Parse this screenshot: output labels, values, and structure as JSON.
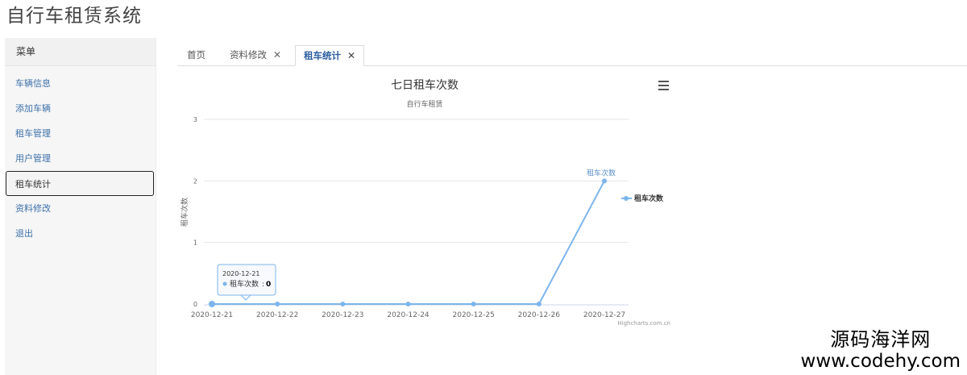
{
  "app": {
    "title": "自行车租赁系统"
  },
  "sidebar": {
    "header": "菜单",
    "items": [
      {
        "label": "车辆信息",
        "active": false
      },
      {
        "label": "添加车辆",
        "active": false
      },
      {
        "label": "租车管理",
        "active": false
      },
      {
        "label": "用户管理",
        "active": false
      },
      {
        "label": "租车统计",
        "active": true
      },
      {
        "label": "资料修改",
        "active": false
      },
      {
        "label": "退出",
        "active": false
      }
    ]
  },
  "tabs": [
    {
      "label": "首页",
      "closable": false,
      "active": false
    },
    {
      "label": "资料修改",
      "closable": true,
      "active": false
    },
    {
      "label": "租车统计",
      "closable": true,
      "active": true
    }
  ],
  "tab_close_glyph": "✕",
  "menu_icon": "hamburger-icon",
  "chart_data": {
    "type": "line",
    "title": "七日租车次数",
    "subtitle": "自行车租赁",
    "ylabel": "租车次数",
    "xlabel": "",
    "categories": [
      "2020-12-21",
      "2020-12-22",
      "2020-12-23",
      "2020-12-24",
      "2020-12-25",
      "2020-12-26",
      "2020-12-27"
    ],
    "series": [
      {
        "name": "租车次数",
        "values": [
          0,
          0,
          0,
          0,
          0,
          0,
          2
        ],
        "color": "#7cb5ec"
      }
    ],
    "ylim": [
      0,
      3
    ],
    "yticks": [
      0,
      1,
      2,
      3
    ],
    "grid": true,
    "legend": "right",
    "end_label": "租车次数",
    "tooltip": {
      "category": "2020-12-21",
      "series": "租车次数",
      "value": "0"
    },
    "credits": "Highcharts.com.cn"
  },
  "watermark": {
    "name": "源码海洋网",
    "url": "www.codehy.com"
  }
}
